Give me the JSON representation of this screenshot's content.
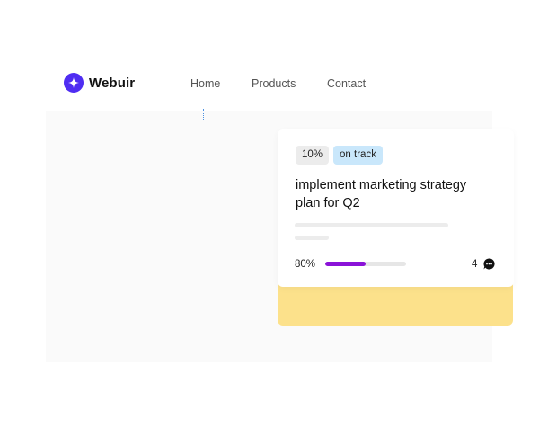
{
  "brand": {
    "name": "Webuir",
    "logo_icon": "plus-sparkle-icon",
    "color": "#4f2df2"
  },
  "nav": {
    "items": [
      "Home",
      "Products",
      "Contact"
    ]
  },
  "task": {
    "percent_badge": "10%",
    "status_badge": "on track",
    "title": "implement marketing strategy plan for Q2",
    "progress_text": "80%",
    "progress_value": 0.5,
    "comment_count": "4",
    "comment_icon": "chat-bubble-icon",
    "colors": {
      "progress": "#8a12d8",
      "status_badge": "#c9e7fb",
      "under_card": "#fce18b"
    }
  }
}
